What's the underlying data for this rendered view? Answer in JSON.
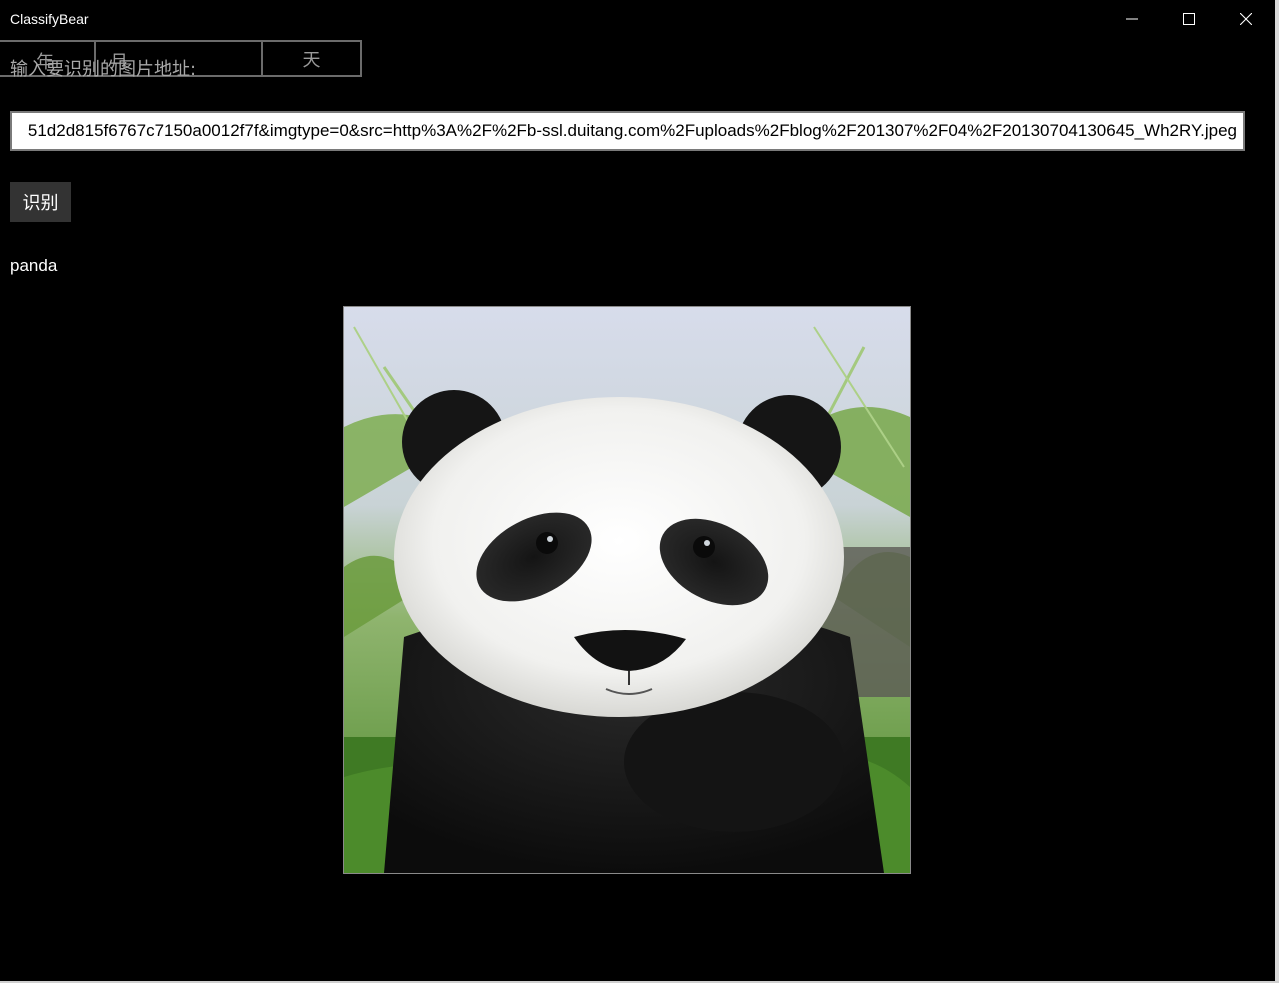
{
  "window": {
    "title": "ClassifyBear"
  },
  "date_picker": {
    "year_label": "年",
    "month_label": "月",
    "day_label": "天"
  },
  "form": {
    "prompt_label": "输入要识别的图片地址:",
    "url_value": "51d2d815f6767c7150a0012f7f&imgtype=0&src=http%3A%2F%2Fb-ssl.duitang.com%2Fuploads%2Fblog%2F201307%2F04%2F20130704130645_Wh2RY.jpeg",
    "recognize_label": "识别"
  },
  "result": {
    "label": "panda"
  },
  "colors": {
    "background": "#000000",
    "button_bg": "#333333",
    "border": "#7a7a7a"
  },
  "icons": {
    "minimize": "minimize-icon",
    "maximize": "maximize-icon",
    "close": "close-icon"
  }
}
